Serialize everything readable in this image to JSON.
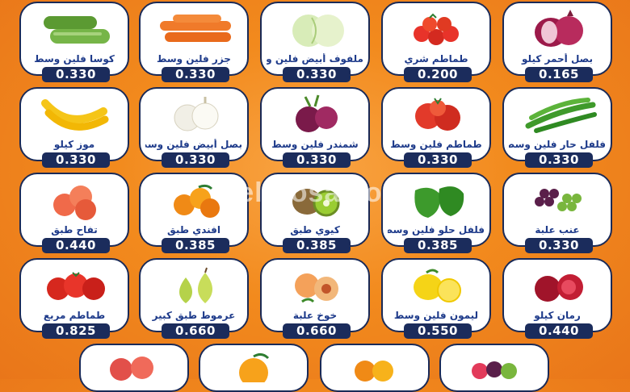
{
  "watermark": "el3rosa.com",
  "rows": [
    [
      {
        "icon": "onion-red-icon",
        "name": "بصل أحمر كيلو",
        "price": "0.165"
      },
      {
        "icon": "tomato-cherry-icon",
        "name": "طماطم شري",
        "price": "0.200"
      },
      {
        "icon": "cabbage-icon",
        "name": "ملفوف أبيض فلين وسط",
        "price": "0.330"
      },
      {
        "icon": "carrot-icon",
        "name": "جزر فلين وسط",
        "price": "0.330"
      },
      {
        "icon": "zucchini-icon",
        "name": "كوسا فلين وسط",
        "price": "0.330"
      }
    ],
    [
      {
        "icon": "green-chili-icon",
        "name": "فلفل حار فلين وسط",
        "price": "0.330"
      },
      {
        "icon": "tomato-icon",
        "name": "طماطم فلين وسط",
        "price": "0.330"
      },
      {
        "icon": "beetroot-icon",
        "name": "شمندر فلين وسط",
        "price": "0.330"
      },
      {
        "icon": "onion-white-icon",
        "name": "بصل أبيض فلين وسط",
        "price": "0.330"
      },
      {
        "icon": "banana-icon",
        "name": "موز كيلو",
        "price": "0.330"
      }
    ],
    [
      {
        "icon": "grapes-icon",
        "name": "عنب علبة",
        "price": "0.330"
      },
      {
        "icon": "bell-pepper-icon",
        "name": "فلفل حلو فلين وسط",
        "price": "0.385"
      },
      {
        "icon": "kiwi-icon",
        "name": "كيوي طبق",
        "price": "0.385"
      },
      {
        "icon": "mandarin-icon",
        "name": "افندي طبق",
        "price": "0.385"
      },
      {
        "icon": "apple-icon",
        "name": "تفاح طبق",
        "price": "0.440"
      }
    ],
    [
      {
        "icon": "pomegranate-icon",
        "name": "رمان كيلو",
        "price": "0.440"
      },
      {
        "icon": "lemon-icon",
        "name": "ليمون فلين وسط",
        "price": "0.550"
      },
      {
        "icon": "peach-icon",
        "name": "خوخ علبة",
        "price": "0.660"
      },
      {
        "icon": "pear-icon",
        "name": "عرموط طبق كبير",
        "price": "0.660"
      },
      {
        "icon": "tomato-box-icon",
        "name": "طماطم مربع",
        "price": "0.825"
      }
    ]
  ],
  "partial_row": [
    {
      "icon": "apple-red-icon"
    },
    {
      "icon": "orange-icon"
    },
    {
      "icon": "orange-mix-icon"
    },
    {
      "icon": "mixed-fruit-icon"
    }
  ]
}
